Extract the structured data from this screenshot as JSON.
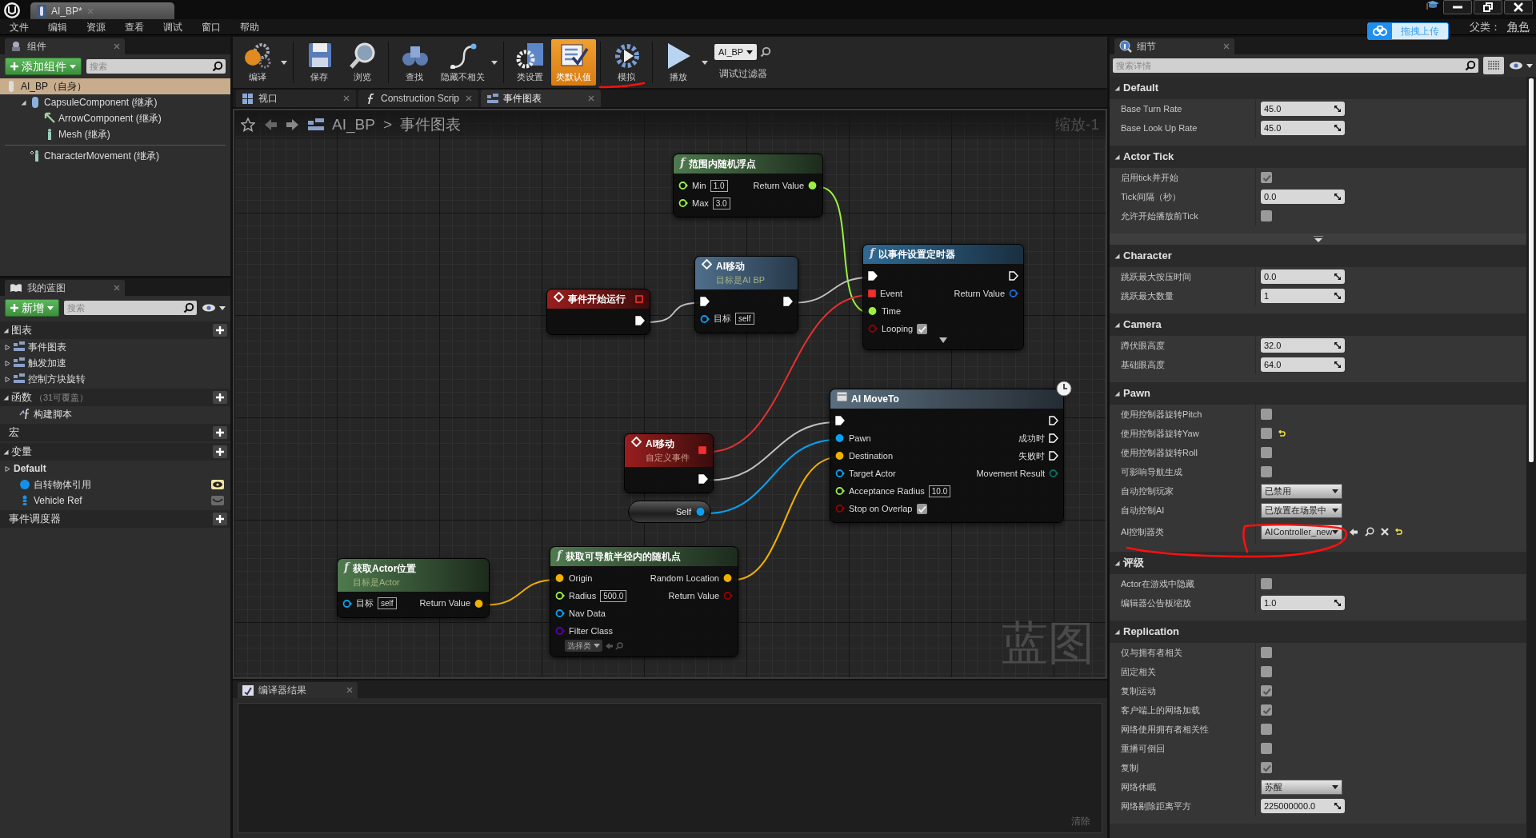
{
  "window": {
    "tab_title": "AI_BP*",
    "menu": [
      "文件",
      "编辑",
      "资源",
      "查看",
      "调试",
      "窗口",
      "帮助"
    ],
    "parent_label": "父类：",
    "parent_value": "角色",
    "upload_button": "拖拽上传"
  },
  "components_panel": {
    "title": "组件",
    "add_button": "添加组件",
    "search_placeholder": "搜索",
    "items": [
      {
        "label": "AI_BP（自身）",
        "kind": "actor",
        "selected": true
      },
      {
        "label": "CapsuleComponent (继承)",
        "kind": "capsule",
        "selected": false,
        "expanded": true,
        "children": [
          {
            "label": "ArrowComponent (继承)",
            "kind": "arrow",
            "selected": false
          },
          {
            "label": "Mesh (继承)",
            "kind": "mesh",
            "selected": false
          }
        ]
      },
      {
        "label": "CharacterMovement (继承)",
        "kind": "movement",
        "selected": false
      }
    ]
  },
  "my_blueprint": {
    "title": "我的蓝图",
    "add_button": "新增",
    "search_placeholder": "搜索",
    "sections": [
      {
        "label": "图表",
        "expanded": true,
        "items": [
          {
            "label": "事件图表",
            "kind": "graph",
            "expanded": false
          },
          {
            "label": "触发加速",
            "kind": "graph",
            "expanded": false
          },
          {
            "label": "控制方块旋转",
            "kind": "graph",
            "expanded": false
          }
        ]
      },
      {
        "label": "函数",
        "note": "（31可覆盖）",
        "expanded": true,
        "items": [
          {
            "label": "构建脚本",
            "kind": "function"
          }
        ]
      },
      {
        "label": "宏"
      },
      {
        "label": "变量",
        "expanded": true,
        "items": [
          {
            "label": "Default",
            "kind": "category",
            "expanded": false
          },
          {
            "label": "自转物体引用",
            "kind": "object_variable",
            "public": true
          },
          {
            "label": "Vehicle Ref",
            "kind": "actor_variable",
            "public": false
          }
        ]
      },
      {
        "label": "事件调度器"
      }
    ]
  },
  "toolbar": {
    "items": [
      {
        "label": "编译",
        "kind": "compile",
        "selected": false,
        "menu": true,
        "separator_after": true
      },
      {
        "label": "保存",
        "kind": "save",
        "selected": false
      },
      {
        "label": "浏览",
        "kind": "browse",
        "selected": false,
        "separator_after": true
      },
      {
        "label": "查找",
        "kind": "find",
        "selected": false
      },
      {
        "label": "隐藏不相关",
        "kind": "hide_unrelated",
        "selected": false,
        "menu": true,
        "separator_after": true
      },
      {
        "label": "类设置",
        "kind": "class_settings",
        "selected": false
      },
      {
        "label": "类默认值",
        "kind": "class_defaults",
        "selected": true,
        "separator_after": true
      },
      {
        "label": "模拟",
        "kind": "simulate",
        "selected": false,
        "separator_after": true
      },
      {
        "label": "播放",
        "kind": "play",
        "selected": false,
        "menu": true
      }
    ],
    "debug_filter": {
      "value": "AI_BP",
      "label": "调试过滤器"
    }
  },
  "document_tabs": [
    {
      "label": "视口",
      "kind": "viewport",
      "selected": false
    },
    {
      "label": "Construction Scrip",
      "kind": "function",
      "selected": false
    },
    {
      "label": "事件图表",
      "kind": "graph",
      "selected": true
    }
  ],
  "graph": {
    "breadcrumb": [
      "AI_BP",
      "事件图表"
    ],
    "breadcrumb_separator": ">",
    "zoom": "缩放-1",
    "watermark": "蓝图",
    "nodes": [
      {
        "kind": "pure",
        "glyph": "f",
        "title": "范围内随机浮点",
        "inputs": [
          {
            "label": "Min",
            "kind": "float",
            "value": "1.0",
            "connected": false
          },
          {
            "label": "Max",
            "kind": "float",
            "value": "3.0",
            "connected": false
          }
        ],
        "outputs": [
          {
            "label": "Return Value",
            "kind": "float",
            "connected": true
          }
        ]
      },
      {
        "kind": "event",
        "title": "事件开始运行",
        "delegate_pin": {
          "connected": false
        },
        "outputs": [
          {
            "kind": "exec",
            "connected": true
          }
        ]
      },
      {
        "kind": "call",
        "title": "AI移动",
        "subtitle": "目标是AI BP",
        "inputs": [
          {
            "kind": "exec",
            "connected": true
          },
          {
            "label": "目标",
            "kind": "object",
            "value": "self",
            "connected": false
          }
        ],
        "outputs": [
          {
            "kind": "exec",
            "connected": true
          }
        ]
      },
      {
        "kind": "function",
        "glyph": "f",
        "title": "以事件设置定时器",
        "inputs": [
          {
            "kind": "exec",
            "connected": true
          },
          {
            "label": "Event",
            "kind": "delegate",
            "connected": true
          },
          {
            "label": "Time",
            "kind": "float",
            "connected": true
          },
          {
            "label": "Looping",
            "kind": "bool",
            "checked": true,
            "connected": false
          }
        ],
        "outputs": [
          {
            "kind": "exec",
            "connected": false
          },
          {
            "label": "Return Value",
            "kind": "struct",
            "connected": false
          }
        ],
        "advanced": true
      },
      {
        "kind": "event",
        "title": "AI移动",
        "subtitle": "自定义事件",
        "delegate_pin": {
          "connected": true
        },
        "outputs": [
          {
            "kind": "exec",
            "connected": true
          }
        ]
      },
      {
        "kind": "variable",
        "outputs": [
          {
            "label": "Self",
            "kind": "object",
            "connected": true
          }
        ]
      },
      {
        "kind": "latent",
        "title": "AI MoveTo",
        "inputs": [
          {
            "kind": "exec",
            "connected": true
          },
          {
            "label": "Pawn",
            "kind": "object",
            "connected": true
          },
          {
            "label": "Destination",
            "kind": "vector",
            "connected": true
          },
          {
            "label": "Target Actor",
            "kind": "object",
            "connected": false
          },
          {
            "label": "Acceptance Radius",
            "kind": "float",
            "value": "10.0",
            "connected": false
          },
          {
            "label": "Stop on Overlap",
            "kind": "bool",
            "checked": true,
            "connected": false
          }
        ],
        "outputs": [
          {
            "kind": "exec",
            "connected": false
          },
          {
            "label": "成功时",
            "kind": "exec",
            "connected": false
          },
          {
            "label": "失败时",
            "kind": "exec",
            "connected": false
          },
          {
            "label": "Movement Result",
            "kind": "enum",
            "connected": false
          }
        ]
      },
      {
        "kind": "pure",
        "glyph": "f",
        "title": "获取Actor位置",
        "subtitle": "目标是Actor",
        "inputs": [
          {
            "label": "目标",
            "kind": "object",
            "value": "self",
            "connected": false
          }
        ],
        "outputs": [
          {
            "label": "Return Value",
            "kind": "vector",
            "connected": true
          }
        ]
      },
      {
        "kind": "pure",
        "glyph": "f",
        "title": "获取可导航半径内的随机点",
        "inputs": [
          {
            "label": "Origin",
            "kind": "vector",
            "connected": true
          },
          {
            "label": "Radius",
            "kind": "float",
            "value": "500.0",
            "connected": false
          },
          {
            "label": "Nav Data",
            "kind": "object",
            "connected": false
          },
          {
            "label": "Filter Class",
            "kind": "class",
            "value": "选择类",
            "connected": false
          }
        ],
        "outputs": [
          {
            "label": "Random Location",
            "kind": "vector",
            "connected": true
          },
          {
            "label": "Return Value",
            "kind": "bool",
            "connected": false
          }
        ]
      }
    ]
  },
  "compiler": {
    "title": "编译器结果",
    "clear_button": "清除"
  },
  "details": {
    "title": "细节",
    "search_placeholder": "搜索详情",
    "categories": [
      {
        "label": "Default",
        "rows": [
          {
            "label": "Base Turn Rate",
            "kind": "number",
            "value": "45.0"
          },
          {
            "label": "Base Look Up Rate",
            "kind": "number",
            "value": "45.0"
          }
        ]
      },
      {
        "label": "Actor Tick",
        "advanced_toggle": true,
        "rows": [
          {
            "label": "启用tick并开始",
            "kind": "checkbox",
            "checked": true
          },
          {
            "label": "Tick间隔（秒）",
            "kind": "number",
            "value": "0.0"
          },
          {
            "label": "允许开始播放前Tick",
            "kind": "checkbox",
            "checked": false
          }
        ]
      },
      {
        "label": "Character",
        "rows": [
          {
            "label": "跳跃最大按压时间",
            "kind": "number",
            "value": "0.0"
          },
          {
            "label": "跳跃最大数量",
            "kind": "number",
            "value": "1"
          }
        ]
      },
      {
        "label": "Camera",
        "rows": [
          {
            "label": "蹲伏眼高度",
            "kind": "number",
            "value": "32.0"
          },
          {
            "label": "基础眼高度",
            "kind": "number",
            "value": "64.0"
          }
        ]
      },
      {
        "label": "Pawn",
        "rows": [
          {
            "label": "使用控制器旋转Pitch",
            "kind": "checkbox",
            "checked": false
          },
          {
            "label": "使用控制器旋转Yaw",
            "kind": "checkbox",
            "checked": false,
            "reset": true
          },
          {
            "label": "使用控制器旋转Roll",
            "kind": "checkbox",
            "checked": false
          },
          {
            "label": "可影响导航生成",
            "kind": "checkbox",
            "checked": false
          },
          {
            "label": "自动控制玩家",
            "kind": "dropdown",
            "value": "已禁用"
          },
          {
            "label": "自动控制AI",
            "kind": "dropdown",
            "value": "已放置在场景中"
          },
          {
            "label": "AI控制器类",
            "kind": "class_picker",
            "value": "AIController_new",
            "reset": true
          }
        ]
      },
      {
        "label": "评级",
        "rows": [
          {
            "label": "Actor在游戏中隐藏",
            "kind": "checkbox",
            "checked": false
          },
          {
            "label": "编辑器公告板缩放",
            "kind": "number",
            "value": "1.0"
          }
        ]
      },
      {
        "label": "Replication",
        "rows": [
          {
            "label": "仅与拥有者相关",
            "kind": "checkbox",
            "checked": false
          },
          {
            "label": "固定相关",
            "kind": "checkbox",
            "checked": false
          },
          {
            "label": "复制运动",
            "kind": "checkbox",
            "checked": true
          },
          {
            "label": "客户端上的网络加载",
            "kind": "checkbox",
            "checked": true
          },
          {
            "label": "网络使用拥有者相关性",
            "kind": "checkbox",
            "checked": false
          },
          {
            "label": "重播可倒回",
            "kind": "checkbox",
            "checked": false
          },
          {
            "label": "复制",
            "kind": "checkbox",
            "checked": true
          },
          {
            "label": "网络休眠",
            "kind": "dropdown",
            "value": "苏醒"
          },
          {
            "label": "网络剔除距离平方",
            "kind": "number",
            "value": "225000000.0"
          }
        ]
      }
    ]
  },
  "annotations": {
    "underline": true,
    "loop": true
  }
}
